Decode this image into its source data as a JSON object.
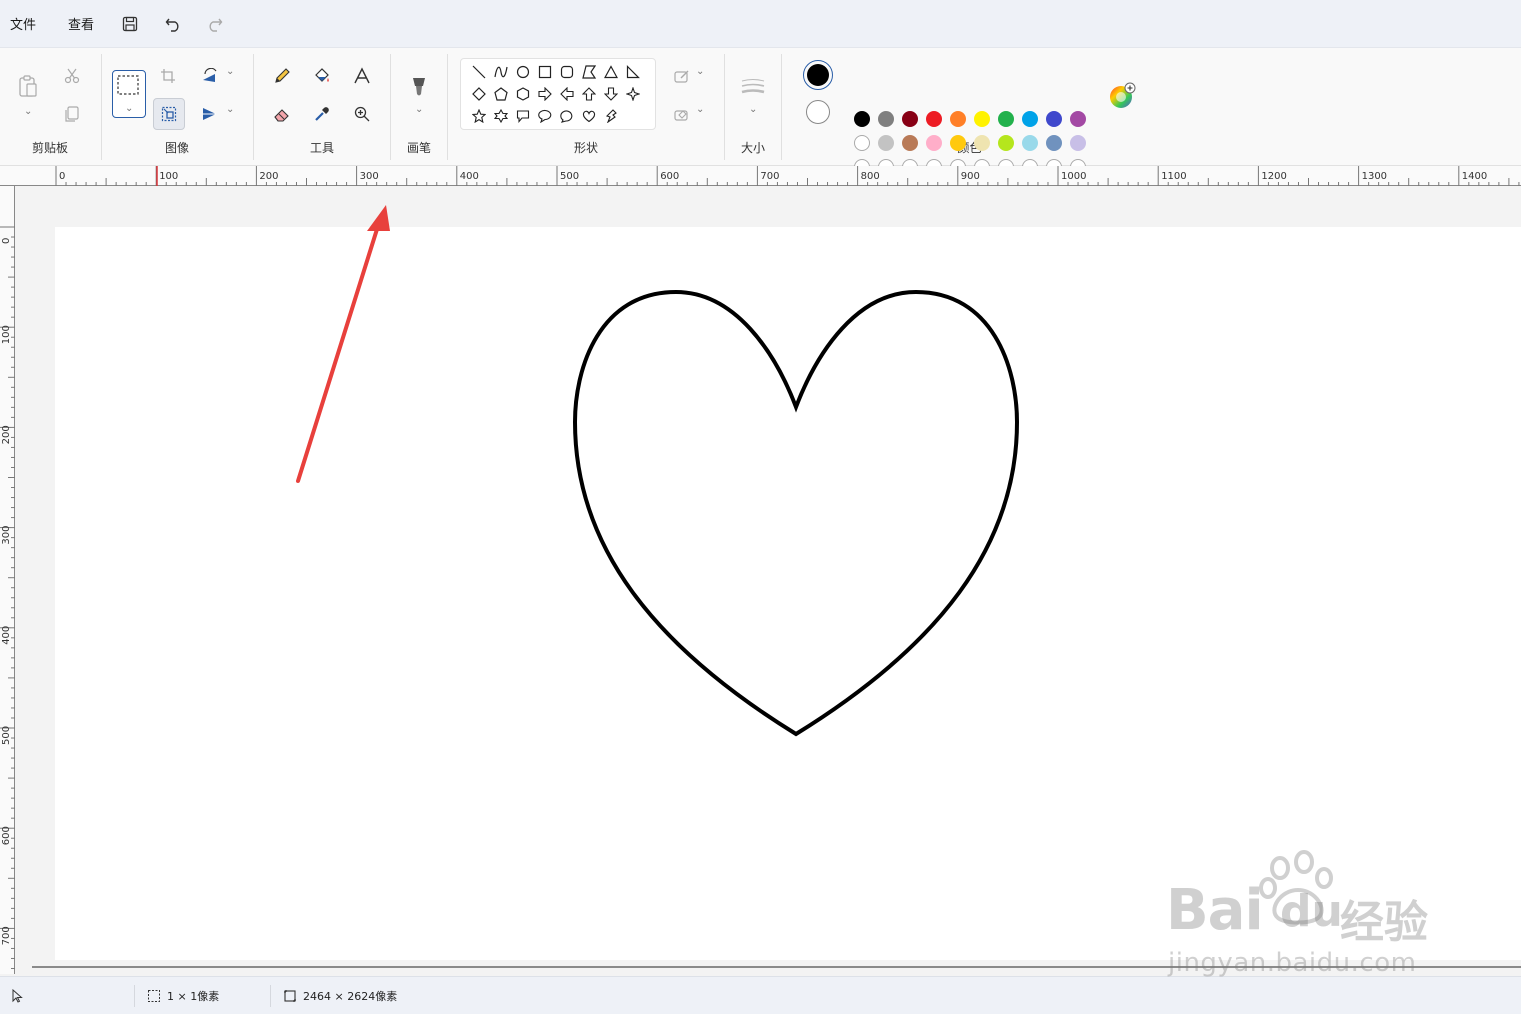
{
  "menubar": {
    "file": "文件",
    "view": "查看"
  },
  "ribbon": {
    "groups": {
      "clipboard": "剪贴板",
      "image": "图像",
      "tools": "工具",
      "brush": "画笔",
      "shapes": "形状",
      "size": "大小",
      "colors": "颜色"
    }
  },
  "colors": {
    "primary": "#000000",
    "secondary": "#ffffff",
    "accent": "#2a5ea8",
    "palette_row1": [
      "#000000",
      "#7f7f7f",
      "#880015",
      "#ed1c24",
      "#ff7f27",
      "#fff200",
      "#22b14c",
      "#00a2e8",
      "#3f48cc",
      "#a349a4"
    ],
    "palette_row2": [
      "#ffffff",
      "#c3c3c3",
      "#b97a57",
      "#ffaec9",
      "#ffc90e",
      "#efe4b0",
      "#b5e61d",
      "#99d9ea",
      "#7092be",
      "#c8bfe7"
    ],
    "annotation_arrow": "#e8403c"
  },
  "ruler": {
    "h_labels": [
      "0",
      "100",
      "200",
      "300",
      "400",
      "500",
      "600",
      "700",
      "800",
      "900",
      "1000",
      "1100",
      "1200",
      "1300",
      "1400"
    ],
    "v_labels": [
      "0",
      "100",
      "200",
      "300",
      "400",
      "500",
      "600",
      "700"
    ]
  },
  "status": {
    "selection_size": "1 × 1像素",
    "canvas_size": "2464 × 2624像素"
  },
  "watermark": {
    "brand": "Bai",
    "brand2": "du",
    "suffix": "经验",
    "url": "jingyan.baidu.com"
  }
}
